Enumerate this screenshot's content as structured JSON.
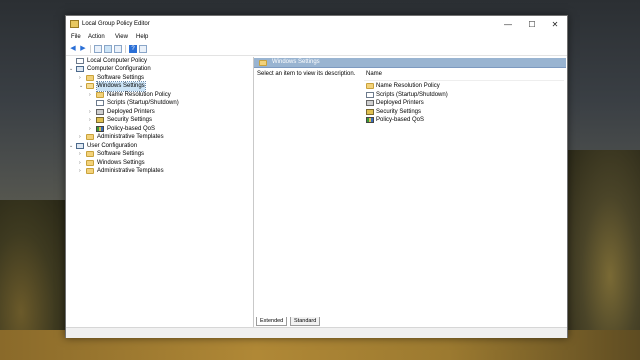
{
  "window": {
    "title": "Local Group Policy Editor",
    "controls": {
      "minimize": "—",
      "maximize": "☐",
      "close": "✕"
    }
  },
  "menu": [
    "File",
    "Action",
    "View",
    "Help"
  ],
  "toolbar": {
    "back": "◀",
    "forward": "▶",
    "help": "?"
  },
  "tree": {
    "root": "Local Computer Policy",
    "computer_configuration": "Computer Configuration",
    "cc_software_settings": "Software Settings",
    "cc_windows_settings": "Windows Settings",
    "name_resolution_policy": "Name Resolution Policy",
    "scripts": "Scripts (Startup/Shutdown)",
    "deployed_printers": "Deployed Printers",
    "security_settings": "Security Settings",
    "policy_based_qos": "Policy-based QoS",
    "cc_admin_templates": "Administrative Templates",
    "user_configuration": "User Configuration",
    "uc_software_settings": "Software Settings",
    "uc_windows_settings": "Windows Settings",
    "uc_admin_templates": "Administrative Templates"
  },
  "details": {
    "header": "Windows Settings",
    "description": "Select an item to view its description.",
    "column_name": "Name",
    "items": [
      "Name Resolution Policy",
      "Scripts (Startup/Shutdown)",
      "Deployed Printers",
      "Security Settings",
      "Policy-based QoS"
    ]
  },
  "tabs": [
    "Extended",
    "Standard"
  ]
}
